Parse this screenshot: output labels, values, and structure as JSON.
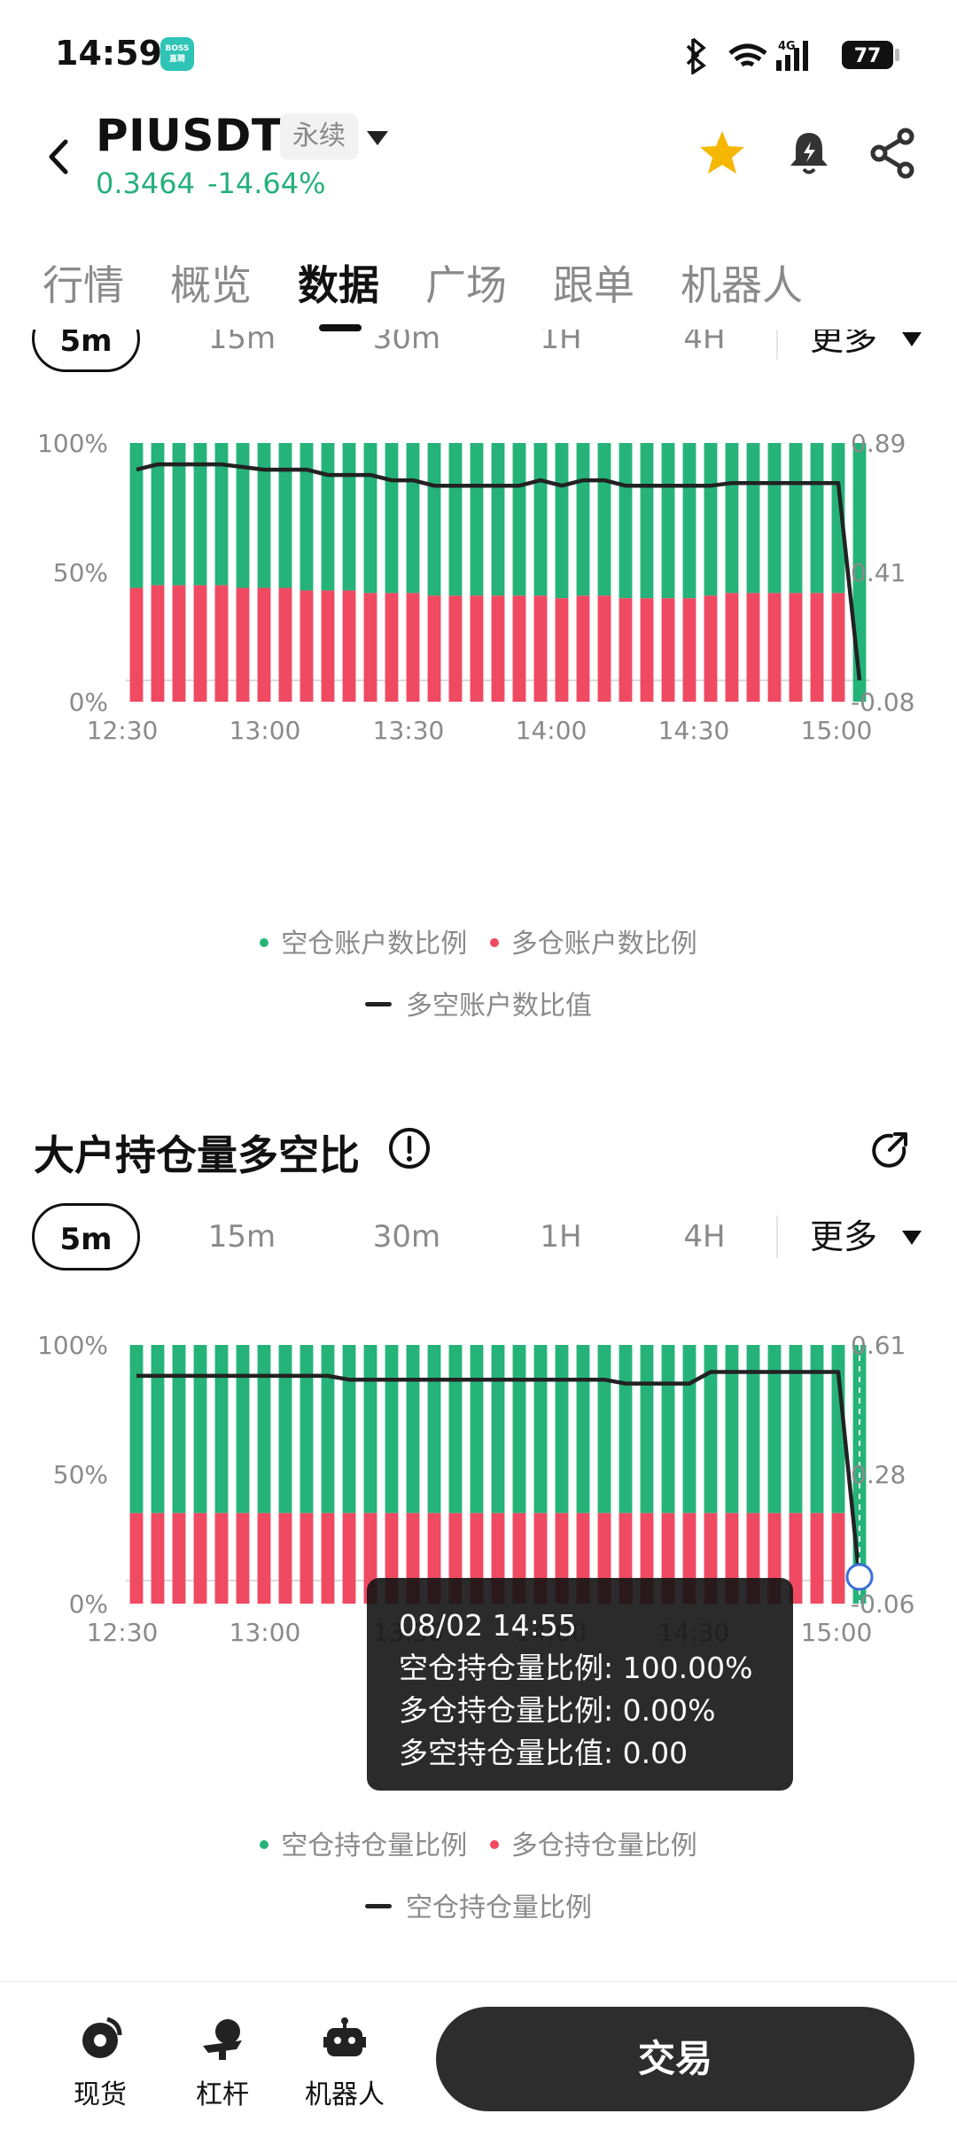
{
  "status_bar": {
    "time": "14:59",
    "app_badge": "BOSS直聘",
    "network": "4G",
    "battery": "77"
  },
  "header": {
    "symbol": "PIUSDT",
    "contract_type": "永续",
    "price": "0.3464",
    "change": "-14.64%",
    "icons": [
      "back-icon",
      "star-icon",
      "bell-alert-icon",
      "share-icon"
    ],
    "accent": "#27b07c",
    "favorite_color": "#f5b700"
  },
  "tabs": [
    "行情",
    "概览",
    "数据",
    "广场",
    "跟单",
    "机器人"
  ],
  "active_tab": "数据",
  "section1": {
    "timeframes": [
      "5m",
      "15m",
      "30m",
      "1H",
      "4H"
    ],
    "active_timeframe": "5m",
    "more_label": "更多",
    "legend": [
      "空仓账户数比例",
      "多仓账户数比例"
    ],
    "line_legend": "多空账户数比值"
  },
  "section2": {
    "title": "大户持仓量多空比",
    "timeframes": [
      "5m",
      "15m",
      "30m",
      "1H",
      "4H"
    ],
    "active_timeframe": "5m",
    "more_label": "更多",
    "legend": [
      "空仓持仓量比例",
      "多仓持仓量比例"
    ],
    "line_legend": "空仓持仓量比例",
    "tooltip": {
      "time": "08/02 14:55",
      "short_ratio": "空仓持仓量比例: 100.00%",
      "long_ratio": "多仓持仓量比例: 0.00%",
      "ls_value": "多空持仓量比值: 0.00"
    }
  },
  "chart_data": [
    {
      "type": "bar",
      "stacked": true,
      "x_ticks": [
        "12:30",
        "13:00",
        "13:30",
        "14:00",
        "14:30",
        "15:00"
      ],
      "y_left_ticks": [
        "100%",
        "50%",
        "0%"
      ],
      "y_right_ticks": [
        "0.89",
        "0.41",
        "-0.08"
      ],
      "colors": {
        "short": "#26b37a",
        "long": "#ef4a62",
        "line": "#222222"
      },
      "series": [
        {
          "name": "多仓账户数比例",
          "values": [
            44,
            45,
            45,
            45,
            45,
            44,
            44,
            44,
            43,
            43,
            43,
            42,
            42,
            42,
            41,
            41,
            41,
            41,
            41,
            41,
            40,
            41,
            41,
            40,
            40,
            40,
            40,
            41,
            42,
            42,
            42,
            42,
            42,
            42,
            0
          ]
        },
        {
          "name": "空仓账户数比例",
          "values": [
            56,
            55,
            55,
            55,
            55,
            56,
            56,
            56,
            57,
            57,
            57,
            58,
            58,
            58,
            59,
            59,
            59,
            59,
            59,
            59,
            60,
            59,
            59,
            60,
            60,
            60,
            60,
            59,
            58,
            58,
            58,
            58,
            58,
            58,
            100
          ]
        },
        {
          "name": "多空账户数比值",
          "values": [
            0.79,
            0.81,
            0.81,
            0.81,
            0.81,
            0.8,
            0.79,
            0.79,
            0.79,
            0.77,
            0.77,
            0.77,
            0.75,
            0.75,
            0.73,
            0.73,
            0.73,
            0.73,
            0.73,
            0.75,
            0.73,
            0.75,
            0.75,
            0.73,
            0.73,
            0.73,
            0.73,
            0.73,
            0.74,
            0.74,
            0.74,
            0.74,
            0.74,
            0.74,
            0.0
          ]
        }
      ],
      "ylim_left": [
        0,
        100
      ],
      "ylim_right": [
        -0.08,
        0.89
      ]
    },
    {
      "type": "bar",
      "stacked": true,
      "x_ticks": [
        "12:30",
        "13:00",
        "13:30",
        "14:00",
        "14:30",
        "15:00"
      ],
      "y_left_ticks": [
        "100%",
        "50%",
        "0%"
      ],
      "y_right_ticks": [
        "0.61",
        "0.28",
        "-0.06"
      ],
      "colors": {
        "short": "#26b37a",
        "long": "#ef4a62",
        "line": "#222222"
      },
      "series": [
        {
          "name": "多仓持仓量比例",
          "values": [
            35,
            35,
            35,
            35,
            35,
            35,
            35,
            35,
            35,
            35,
            35,
            35,
            35,
            35,
            35,
            35,
            35,
            35,
            35,
            35,
            35,
            35,
            35,
            35,
            35,
            35,
            35,
            35,
            35,
            35,
            35,
            35,
            35,
            35,
            0
          ]
        },
        {
          "name": "空仓持仓量比例",
          "values": [
            65,
            65,
            65,
            65,
            65,
            65,
            65,
            65,
            65,
            65,
            65,
            65,
            65,
            65,
            65,
            65,
            65,
            65,
            65,
            65,
            65,
            65,
            65,
            65,
            65,
            65,
            65,
            65,
            65,
            65,
            65,
            65,
            65,
            65,
            100
          ]
        },
        {
          "name": "空仓持仓量比例",
          "values": [
            0.53,
            0.53,
            0.53,
            0.53,
            0.53,
            0.53,
            0.53,
            0.53,
            0.53,
            0.53,
            0.52,
            0.52,
            0.52,
            0.52,
            0.52,
            0.52,
            0.52,
            0.52,
            0.52,
            0.52,
            0.52,
            0.52,
            0.52,
            0.51,
            0.51,
            0.51,
            0.51,
            0.54,
            0.54,
            0.54,
            0.54,
            0.54,
            0.54,
            0.54,
            0.0
          ]
        }
      ],
      "ylim_left": [
        0,
        100
      ],
      "ylim_right": [
        -0.06,
        0.61
      ]
    }
  ],
  "bottom_nav": {
    "items": [
      "现货",
      "杠杆",
      "机器人"
    ],
    "icons": [
      "spot-icon",
      "leverage-icon",
      "robot-icon"
    ],
    "trade_label": "交易"
  }
}
